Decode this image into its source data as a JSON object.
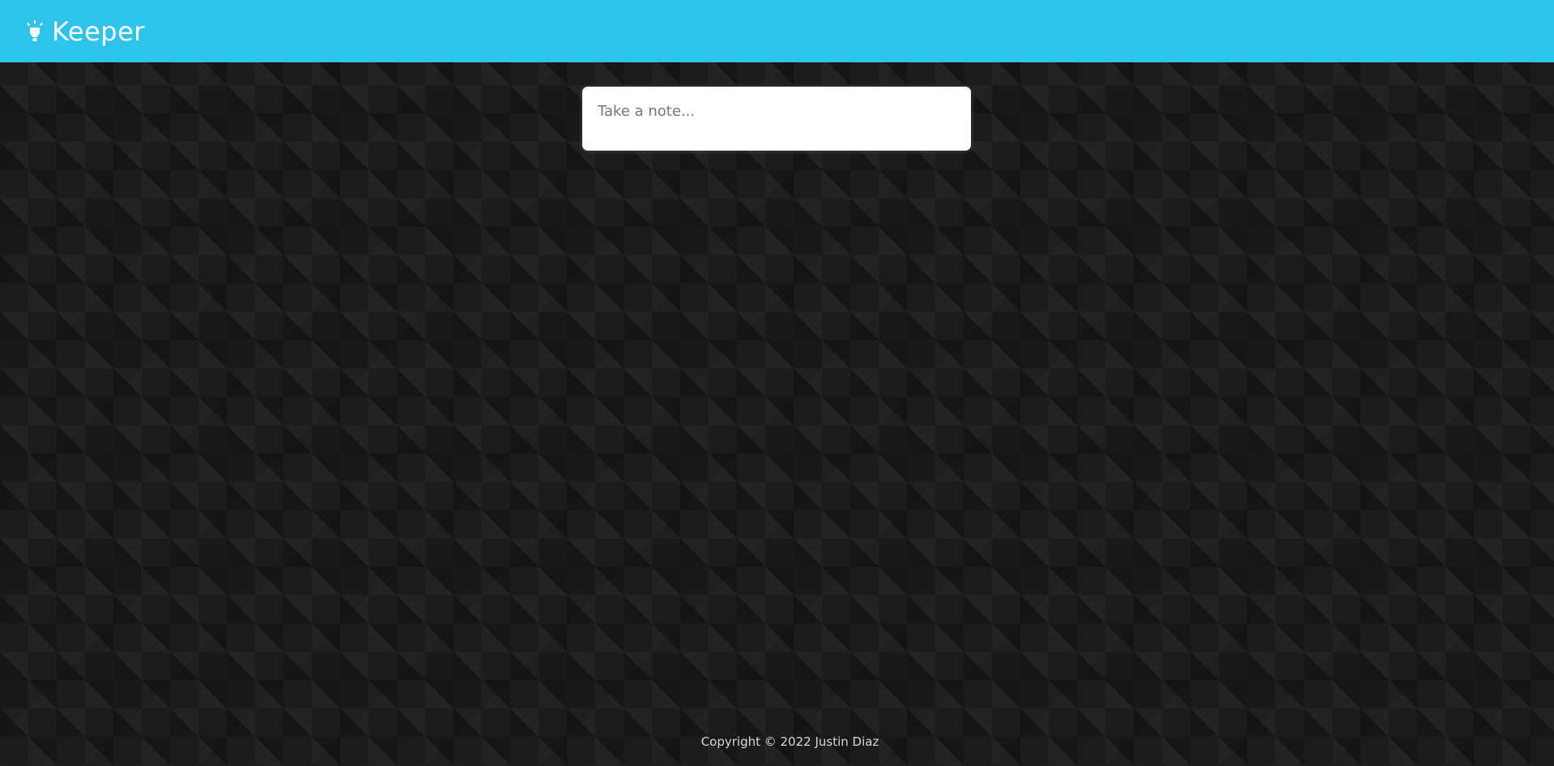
{
  "header": {
    "title": "Keeper",
    "logo_icon": "lightbulb-icon",
    "background_color": "#2ec3ea"
  },
  "note_form": {
    "placeholder": "Take a note..."
  },
  "footer": {
    "copyright": "Copyright © 2022 Justin Diaz"
  }
}
